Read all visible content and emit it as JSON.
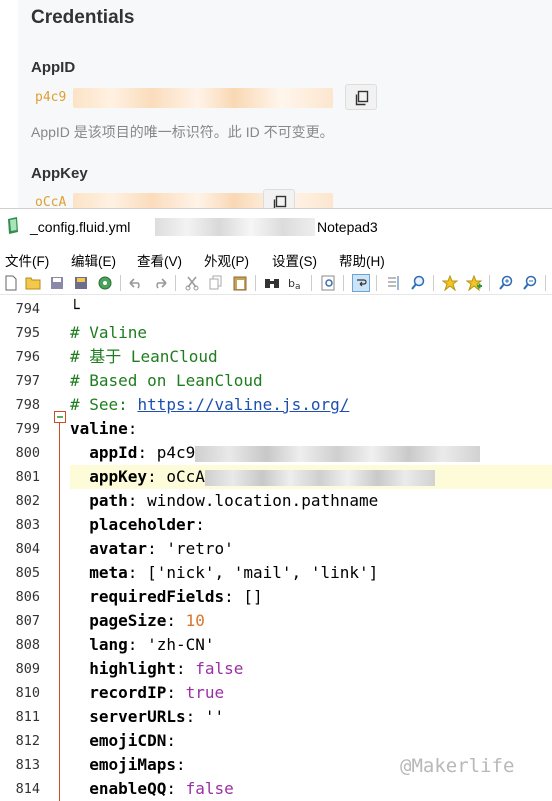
{
  "web": {
    "heading": "Credentials",
    "appid_label": "AppID",
    "appid_value_prefix": "p4c9",
    "appid_desc": "AppID 是该项目的唯一标识符。此 ID 不可变更。",
    "appkey_label": "AppKey",
    "appkey_value_prefix": "oCcA"
  },
  "window": {
    "title": "_config.fluid.yml",
    "title_app": "Notepad3"
  },
  "menu": [
    "文件(F)",
    "编辑(E)",
    "查看(V)",
    "外观(P)",
    "设置(S)",
    "帮助(H)"
  ],
  "editor": {
    "current_line": 801,
    "lines": [
      {
        "n": "794",
        "tokens": [
          {
            "t": "└",
            "c": "punc"
          }
        ]
      },
      {
        "n": "795",
        "tokens": [
          {
            "t": "# Valine",
            "c": "comment"
          }
        ]
      },
      {
        "n": "796",
        "tokens": [
          {
            "t": "# 基于 LeanCloud",
            "c": "comment"
          }
        ]
      },
      {
        "n": "797",
        "tokens": [
          {
            "t": "# Based on LeanCloud",
            "c": "comment"
          }
        ]
      },
      {
        "n": "798",
        "tokens": [
          {
            "t": "# See: ",
            "c": "comment"
          },
          {
            "t": "https://valine.js.org/",
            "c": "url"
          }
        ]
      },
      {
        "n": "799",
        "tokens": [
          {
            "t": "valine",
            "c": "key"
          },
          {
            "t": ":",
            "c": "punc"
          }
        ]
      },
      {
        "n": "800",
        "tokens": [
          {
            "t": "  appId",
            "c": "key"
          },
          {
            "t": ": p4c9",
            "c": "str"
          }
        ]
      },
      {
        "n": "801",
        "tokens": [
          {
            "t": "  appKey",
            "c": "key"
          },
          {
            "t": ": oCcA",
            "c": "str"
          }
        ]
      },
      {
        "n": "802",
        "tokens": [
          {
            "t": "  path",
            "c": "key"
          },
          {
            "t": ": window.location.pathname",
            "c": "str"
          }
        ]
      },
      {
        "n": "803",
        "tokens": [
          {
            "t": "  placeholder",
            "c": "key"
          },
          {
            "t": ":",
            "c": "punc"
          }
        ]
      },
      {
        "n": "804",
        "tokens": [
          {
            "t": "  avatar",
            "c": "key"
          },
          {
            "t": ": 'retro'",
            "c": "str"
          }
        ]
      },
      {
        "n": "805",
        "tokens": [
          {
            "t": "  meta",
            "c": "key"
          },
          {
            "t": ": ['nick', 'mail', 'link']",
            "c": "str"
          }
        ]
      },
      {
        "n": "806",
        "tokens": [
          {
            "t": "  requiredFields",
            "c": "key"
          },
          {
            "t": ": []",
            "c": "str"
          }
        ]
      },
      {
        "n": "807",
        "tokens": [
          {
            "t": "  pageSize",
            "c": "key"
          },
          {
            "t": ": ",
            "c": "punc"
          },
          {
            "t": "10",
            "c": "num"
          }
        ]
      },
      {
        "n": "808",
        "tokens": [
          {
            "t": "  lang",
            "c": "key"
          },
          {
            "t": ": 'zh-CN'",
            "c": "str"
          }
        ]
      },
      {
        "n": "809",
        "tokens": [
          {
            "t": "  highlight",
            "c": "key"
          },
          {
            "t": ": ",
            "c": "punc"
          },
          {
            "t": "false",
            "c": "bool"
          }
        ]
      },
      {
        "n": "810",
        "tokens": [
          {
            "t": "  recordIP",
            "c": "key"
          },
          {
            "t": ": ",
            "c": "punc"
          },
          {
            "t": "true",
            "c": "bool"
          }
        ]
      },
      {
        "n": "811",
        "tokens": [
          {
            "t": "  serverURLs",
            "c": "key"
          },
          {
            "t": ": ''",
            "c": "str"
          }
        ]
      },
      {
        "n": "812",
        "tokens": [
          {
            "t": "  emojiCDN",
            "c": "key"
          },
          {
            "t": ":",
            "c": "punc"
          }
        ]
      },
      {
        "n": "813",
        "tokens": [
          {
            "t": "  emojiMaps",
            "c": "key"
          },
          {
            "t": ":",
            "c": "punc"
          }
        ]
      },
      {
        "n": "814",
        "tokens": [
          {
            "t": "  enableQQ",
            "c": "key"
          },
          {
            "t": ": ",
            "c": "punc"
          },
          {
            "t": "false",
            "c": "bool"
          }
        ]
      }
    ]
  },
  "watermark": "@Makerlife",
  "colors": {
    "comment": "#1e7d1e",
    "url": "#1d4fb0",
    "number": "#d8752b",
    "boolean": "#9b2fa6",
    "current_line_bg": "#fdfbd8",
    "fold_marker": "#d04b2a",
    "secret_value": "#e0a030"
  }
}
